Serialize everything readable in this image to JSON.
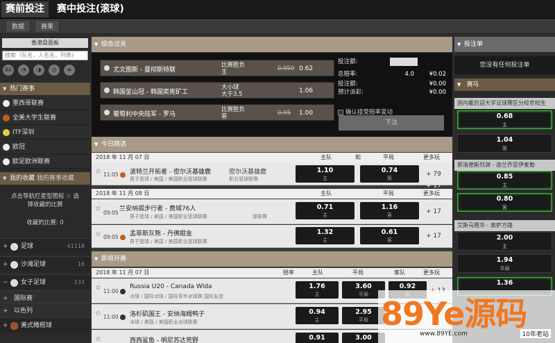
{
  "tabs": {
    "prematch": "赛前投注",
    "inplay": "赛中投注(滚球)"
  },
  "subtabs": {
    "data": "数据",
    "results": "赛果"
  },
  "sidebar": {
    "filter": "香港盘面板",
    "search_placeholder": "搜索（队名，人名名，列表)",
    "icon_all": "All",
    "hot_title": "热门赛事",
    "hot": [
      "墨西哥联赛",
      "全美大学生联赛",
      "ITF深圳",
      "欧冠",
      "欧足欧洲联赛"
    ],
    "fav_title": "我的收藏",
    "fav_title2": "我的赛事收藏",
    "fav_hint1": "点击导航栏星型图标 ☆ 选",
    "fav_hint2": "择收藏的比赛",
    "fav_count": "收藏的比赛: 0",
    "sports": [
      {
        "pm": "+",
        "name": "足球",
        "count": "41118"
      },
      {
        "pm": "+",
        "name": "沙滩足球",
        "count": "16"
      },
      {
        "pm": "−",
        "name": "女子足球",
        "count": "133"
      },
      {
        "pm": "+",
        "name": "国际赛",
        "count": ""
      },
      {
        "pm": "+",
        "name": "以色列",
        "count": ""
      },
      {
        "pm": "+",
        "name": "美式橄榄球",
        "count": ""
      }
    ]
  },
  "parlay": {
    "title": "综合过关",
    "legs": [
      {
        "teams": "尤文图斯 - 曼彻斯特联",
        "bet1": "比赛胜负",
        "bet2": "主",
        "old": "0.959",
        "odds": "0.62"
      },
      {
        "teams": "韩国釜山冠 - 韩国奕宪矿工",
        "bet1": "大小球",
        "bet2": "大于3.5",
        "old": "",
        "odds": "1.06"
      },
      {
        "teams": "葡萄利中央陆军 - 罗马",
        "bet1": "比赛胜负",
        "bet2": "客",
        "old": "0.95",
        "odds": "1.00"
      }
    ],
    "stake_label": "投注额:",
    "total_odds_label": "总赔率:",
    "total_odds": "4.0",
    "stake_value_label": "投注额:",
    "payout_label": "预计派彩:",
    "total_odds_money": "¥0.02",
    "stake_money": "¥0.00",
    "payout_money": "¥0.00",
    "accept": "确认接受赔率变动",
    "place": "下注"
  },
  "today": {
    "title": "今日精选",
    "dates": [
      "2018 年 11 月 07 日",
      "2018 年 11 月 08 日",
      "2018 年 11 月 07 日"
    ],
    "col_home": "主队",
    "col_draw": "和",
    "col_away": "平局",
    "col_more": "更多玩",
    "matches": [
      {
        "time": "11:05",
        "teams": "波特兰开拓者 - 密尔沃基雄鹿",
        "teams_r": "密尔沃基雄鹿",
        "league": "男子篮球 / 美国 / 美国职业篮球联赛",
        "league_r": "职业篮球联赛",
        "h": "1.10",
        "hs": "主",
        "a": "0.74",
        "as": "客",
        "more": "+ 79"
      },
      {
        "time": "09:05",
        "teams": "兰安纳孤步行者 - 费城76人",
        "league": "男子篮球 / 美国 / 美国职业篮球联赛",
        "league_r": "球联赛",
        "h": "0.71",
        "hs": "主",
        "a": "1.16",
        "as": "客",
        "more": "+ 17"
      },
      {
        "time": "09:05",
        "teams": "孟菲斯灰熊 - 丹佛掘金",
        "league": "男子篮球 / 美国 / 美国职业篮球联赛",
        "h": "1.32",
        "hs": "主",
        "a": "0.61",
        "as": "客",
        "more": "+ 17"
      }
    ],
    "extra_more": "+ 17"
  },
  "soon": {
    "title": "即将开赛",
    "col_rate": "赔率",
    "col_home": "主队",
    "col_draw": "平局",
    "col_away": "客队",
    "col_more": "更多玩",
    "matches": [
      {
        "time": "11:00",
        "teams": "Russia U20 - Canada Wlda",
        "league": "冰球 / 国际冰球 / 国际青年冰球赛  国际友谊",
        "h": "1.76",
        "hs": "主",
        "d": "3.60",
        "ds": "平局",
        "a": "0.92",
        "as": "客",
        "more": "+ 13"
      },
      {
        "time": "11:00",
        "teams": "洛杉矶国王 - 安纳海姆鸭子",
        "league": "冰球 / 美国 / 美国职业冰球联赛",
        "h": "0.94",
        "hs": "主",
        "d": "2.95",
        "ds": "平局",
        "a": "",
        "as": "",
        "more": ""
      },
      {
        "time": "",
        "teams": "西西鲨鱼 - 明尼苏达荒野",
        "league": "",
        "h": "0.91",
        "hs": "",
        "d": "3.00",
        "ds": "",
        "a": "",
        "as": "",
        "more": ""
      }
    ]
  },
  "betslip": {
    "title": "投注单",
    "empty": "您没有任何投注单",
    "hot_title": "赛马",
    "groups": [
      {
        "match": "国内衢后迎大学足球赛区分校农校生",
        "odds": [
          {
            "v": "0.68",
            "s": "主",
            "green": true
          },
          {
            "v": "1.04",
            "s": "客",
            "green": false
          }
        ]
      },
      {
        "match": "那洛德斯烈渊 - 迦兰乔亚伊麦勒",
        "odds": [
          {
            "v": "0.85",
            "s": "主",
            "green": true
          },
          {
            "v": "0.80",
            "s": "客",
            "green": true
          }
        ]
      },
      {
        "match": "艾斯马霞华 - 奥萨方路",
        "odds": [
          {
            "v": "2.00",
            "s": "主",
            "green": false
          },
          {
            "v": "1.94",
            "s": "平局",
            "green": false
          },
          {
            "v": "1.36",
            "s": "",
            "green": true
          }
        ]
      }
    ]
  },
  "watermark": {
    "logo": "89Ye源码",
    "url": "www.89YE.com",
    "tag": "10年老站"
  },
  "colors": {
    "accent": "#6b5a44",
    "header": "#a89a87",
    "green": "#3bbf3b"
  }
}
